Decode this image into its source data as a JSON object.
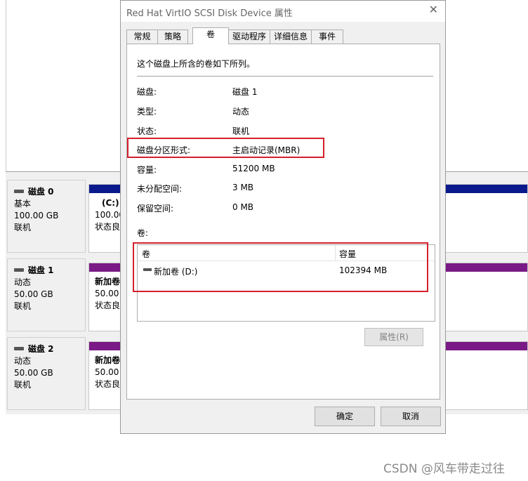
{
  "background": {
    "disks": [
      {
        "name": "磁盘 0",
        "type": "基本",
        "size": "100.00 GB",
        "status": "联机",
        "part_title": "(C:)",
        "part_line2": "100.00",
        "part_line3": "状态良",
        "bar_color": "#0a1a8c"
      },
      {
        "name": "磁盘 1",
        "type": "动态",
        "size": "50.00 GB",
        "status": "联机",
        "part_title": "新加卷",
        "part_line2": "50.00",
        "part_line3": "状态良",
        "bar_color": "#7a1a86"
      },
      {
        "name": "磁盘 2",
        "type": "动态",
        "size": "50.00 GB",
        "status": "联机",
        "part_title": "新加卷",
        "part_line2": "50.00",
        "part_line3": "状态良",
        "bar_color": "#7a1a86"
      }
    ]
  },
  "dialog": {
    "title": "Red Hat VirtIO SCSI Disk Device 属性",
    "close_icon": "close-icon",
    "tabs": [
      {
        "label": "常规",
        "active": false
      },
      {
        "label": "策略",
        "active": false
      },
      {
        "label": "卷",
        "active": true
      },
      {
        "label": "驱动程序",
        "active": false
      },
      {
        "label": "详细信息",
        "active": false
      },
      {
        "label": "事件",
        "active": false
      }
    ],
    "description": "这个磁盘上所含的卷如下所列。",
    "properties": {
      "disk": {
        "label": "磁盘:",
        "value": "磁盘 1"
      },
      "type": {
        "label": "类型:",
        "value": "动态"
      },
      "status": {
        "label": "状态:",
        "value": "联机"
      },
      "partition_style": {
        "label": "磁盘分区形式:",
        "value": "主启动记录(MBR)"
      },
      "capacity": {
        "label": "容量:",
        "value": "51200 MB"
      },
      "unallocated": {
        "label": "未分配空间:",
        "value": "3 MB"
      },
      "reserved": {
        "label": "保留空间:",
        "value": "0 MB"
      }
    },
    "volumes_label": "卷:",
    "volumes_table": {
      "columns": [
        "卷",
        "容量"
      ],
      "rows": [
        {
          "volume": "新加卷 (D:)",
          "capacity": "102394 MB"
        }
      ]
    },
    "properties_button": "属性(R)",
    "ok_button": "确定",
    "cancel_button": "取消",
    "highlight_color": "#d4202c"
  },
  "watermark": "CSDN @风车带走过往"
}
